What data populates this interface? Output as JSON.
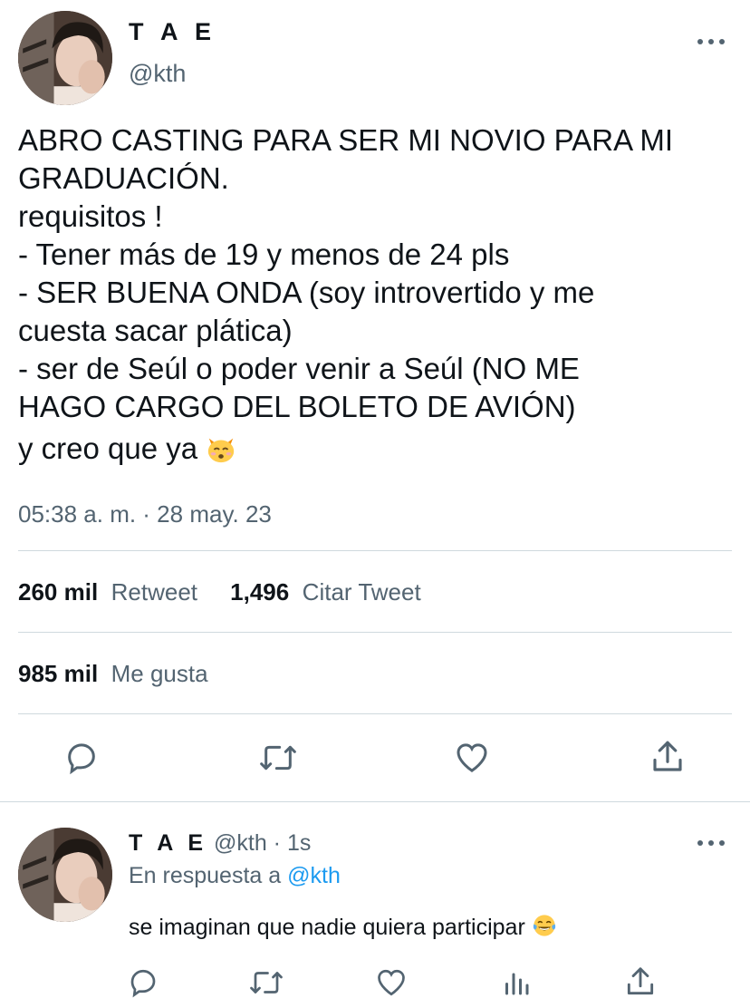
{
  "main_tweet": {
    "display_name": "T A E",
    "handle": "@kth",
    "text": "ABRO CASTING PARA SER MI NOVIO PARA MI\nGRADUACIÓN.\nrequisitos !\n- Tener más de 19 y menos de 24 pls\n- SER BUENA ONDA (soy introvertido y me\ncuesta sacar plática)\n- ser de Seúl o poder venir a Seúl (NO ME\nHAGO CARGO DEL BOLETO DE AVIÓN)",
    "last_line": "y creo que ya",
    "emoji": "kissing-cat-emoji",
    "timestamp": "05:38 a. m. · 28 may. 23",
    "retweets_count": "260 mil",
    "retweets_label": "Retweet",
    "quotes_count": "1,496",
    "quotes_label": "Citar Tweet",
    "likes_count": "985 mil",
    "likes_label": "Me gusta"
  },
  "reply_tweet": {
    "display_name": "T A E",
    "handle_time": "@kth · 1s",
    "in_reply_prefix": "En respuesta a",
    "in_reply_handle": "@kth",
    "text": "se imaginan que nadie quiera participar",
    "emoji": "tears-of-joy-emoji"
  },
  "icons": {
    "reply": "reply-icon",
    "retweet": "retweet-icon",
    "like": "heart-icon",
    "share": "share-icon",
    "analytics": "analytics-icon",
    "more": "more-icon"
  },
  "colors": {
    "text": "#0f1419",
    "secondary": "#536471",
    "link": "#1d9bf0",
    "divider": "#cfd9de"
  }
}
